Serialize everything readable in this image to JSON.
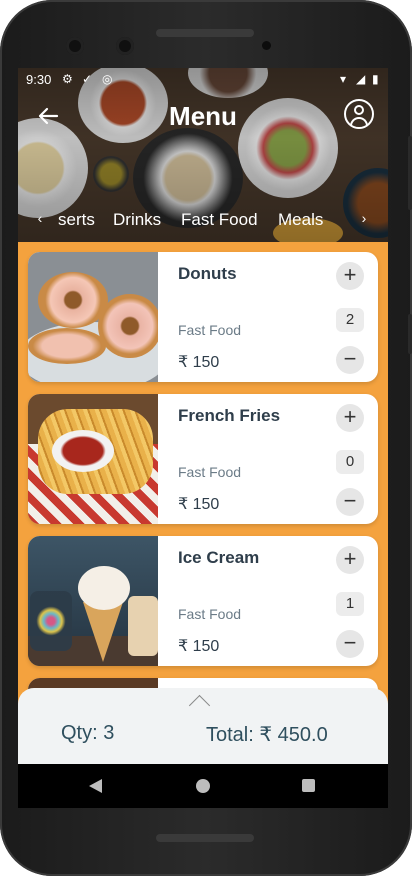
{
  "status_bar": {
    "time": "9:30"
  },
  "header": {
    "title": "Menu"
  },
  "categories": {
    "prev_arrow": "‹",
    "next_arrow": "›",
    "items": [
      "serts",
      "Drinks",
      "Fast Food",
      "Meals"
    ]
  },
  "items": [
    {
      "name": "Donuts",
      "category": "Fast Food",
      "price": "₹ 150",
      "quantity": "2"
    },
    {
      "name": "French Fries",
      "category": "Fast Food",
      "price": "₹ 150",
      "quantity": "0"
    },
    {
      "name": "Ice Cream",
      "category": "Fast Food",
      "price": "₹ 150",
      "quantity": "1"
    }
  ],
  "buttons": {
    "plus": "+",
    "minus": "−"
  },
  "summary": {
    "qty": "Qty: 3",
    "total": "Total: ₹ 450.0"
  },
  "colors": {
    "accent": "#f4a23e",
    "text_dark": "#2f3e4b"
  }
}
